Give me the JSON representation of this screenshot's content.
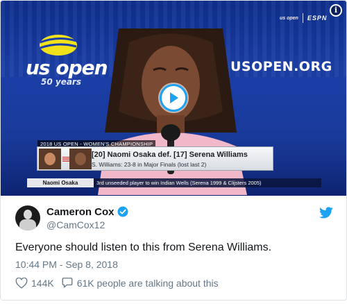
{
  "video": {
    "brand": "us open",
    "brand_sub": "50 years",
    "site": "USOPEN.ORG",
    "broadcaster_small": "us open",
    "broadcaster": "ESPN",
    "graphic_label": "2018 US OPEN - WOMEN'S CHAMPIONSHIP",
    "result_line": "[20] Naomi Osaka def. [17] Serena Williams",
    "sub_line": "S. Williams: 23-8 in Major Finals (lost last 2)",
    "ticker_name": "Naomi Osaka",
    "ticker_text": "3rd unseeded player to win Indian Wells (Serena 1999 & Clijsters 2005)",
    "info_label": "i"
  },
  "tweet": {
    "display_name": "Cameron Cox",
    "handle": "@CamCox12",
    "text": "Everyone should listen to this from Serena Williams.",
    "timestamp": "10:44 PM - Sep 8, 2018",
    "likes": "144K",
    "replies_text": "61K people are talking about this"
  },
  "colors": {
    "accent": "#1da1f2",
    "muted": "#657786",
    "text": "#14171a",
    "stage": "#1b3fa8"
  },
  "icons": {
    "verified": "verified-badge-icon",
    "bird": "twitter-bird-icon",
    "heart": "heart-icon",
    "reply": "speech-bubble-icon",
    "play": "play-icon",
    "info": "info-icon"
  }
}
